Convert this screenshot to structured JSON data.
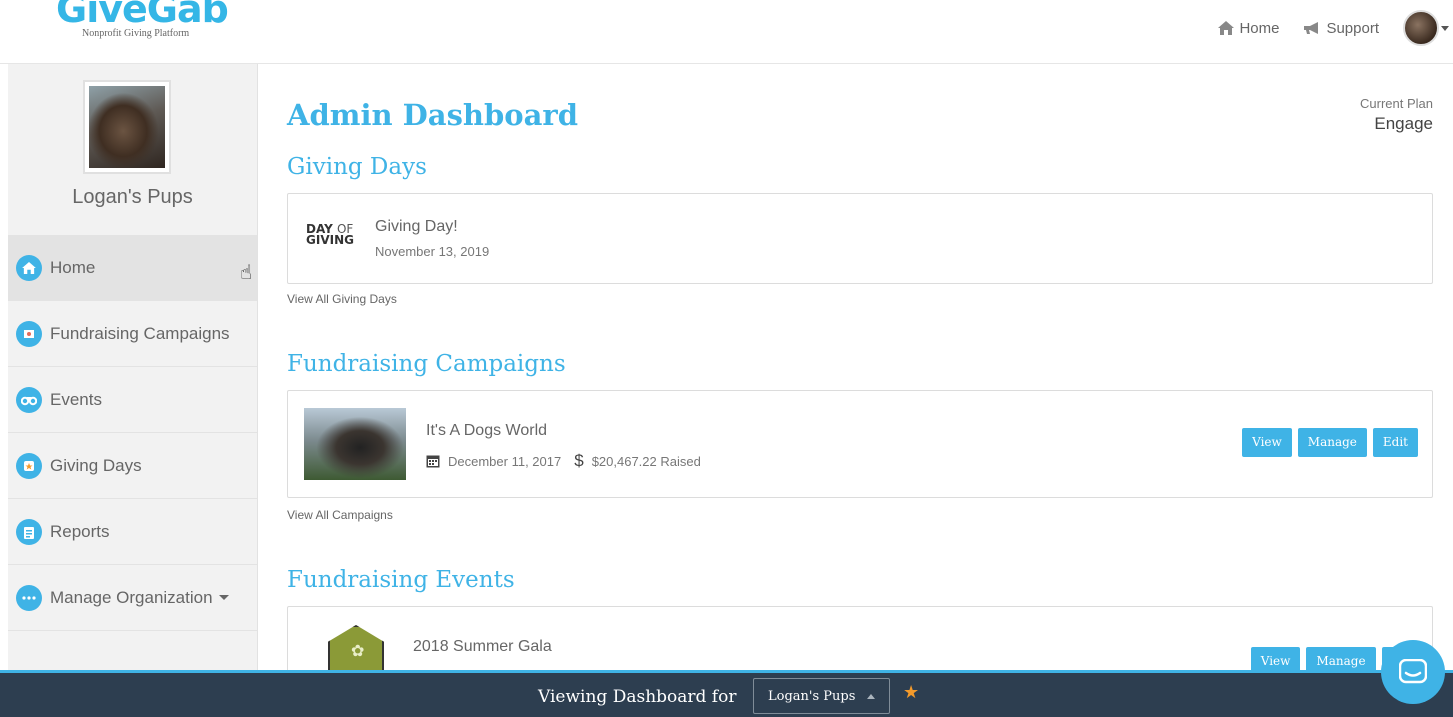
{
  "brand": {
    "name": "GiveGab",
    "tagline": "Nonprofit Giving Platform"
  },
  "topnav": {
    "home": "Home",
    "support": "Support"
  },
  "sidebar": {
    "org_name": "Logan's Pups",
    "items": [
      {
        "label": "Home",
        "icon": "home-icon",
        "active": true
      },
      {
        "label": "Fundraising Campaigns",
        "icon": "campaign-flag-icon"
      },
      {
        "label": "Events",
        "icon": "binoculars-icon"
      },
      {
        "label": "Giving Days",
        "icon": "giving-day-icon"
      },
      {
        "label": "Reports",
        "icon": "clipboard-icon"
      },
      {
        "label": "Manage Organization",
        "icon": "more-dots-icon"
      }
    ]
  },
  "main": {
    "title": "Admin Dashboard",
    "plan_label": "Current Plan",
    "plan_value": "Engage",
    "giving_days": {
      "heading": "Giving Days",
      "logo_top": "DAY",
      "logo_of": "OF",
      "logo_bottom": "GIVING",
      "item_title": "Giving Day!",
      "item_date": "November 13, 2019",
      "view_all": "View All Giving Days"
    },
    "campaigns": {
      "heading": "Fundraising Campaigns",
      "item_title": "It's A Dogs World",
      "item_date": "December 11, 2017",
      "item_raised": "$20,467.22 Raised",
      "view_all": "View All Campaigns"
    },
    "events": {
      "heading": "Fundraising Events",
      "item_title": "2018 Summer Gala"
    },
    "buttons": {
      "view": "View",
      "manage": "Manage",
      "edit": "Edit",
      "edit_partial": "Ed"
    }
  },
  "bottom": {
    "viewing_label": "Viewing Dashboard for",
    "selected_org": "Logan's Pups"
  },
  "colors": {
    "accent": "#3fb3e6",
    "bottom_bar": "#2d3e50",
    "star": "#f39a2b"
  }
}
